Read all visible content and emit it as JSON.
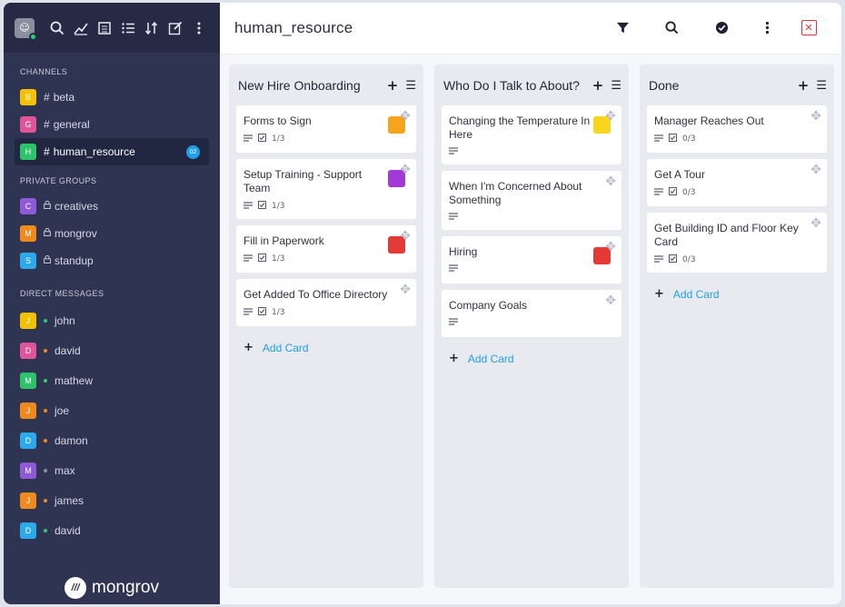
{
  "sidebar": {
    "avatar_glyph": "☺",
    "top_icons": [
      "search-icon",
      "chart-icon",
      "directory-icon",
      "list-icon",
      "sort-icon",
      "edit-icon",
      "more-icon"
    ],
    "sections": {
      "channels": "CHANNELS",
      "private_groups": "PRIVATE GROUPS",
      "direct_messages": "DIRECT MESSAGES"
    },
    "channels": [
      {
        "letter": "B",
        "name": "beta",
        "color": "#f2c200"
      },
      {
        "letter": "G",
        "name": "general",
        "color": "#e0559a"
      },
      {
        "letter": "H",
        "name": "human_resource",
        "color": "#2ec36b",
        "badge": "02"
      }
    ],
    "groups": [
      {
        "letter": "C",
        "name": "creatives",
        "color": "#8e5ad8"
      },
      {
        "letter": "M",
        "name": "mongrov",
        "color": "#f08a1c"
      },
      {
        "letter": "S",
        "name": "standup",
        "color": "#2ba9e8"
      }
    ],
    "dms": [
      {
        "letter": "J",
        "name": "john",
        "color": "#f2c200",
        "status": "#2ecc71"
      },
      {
        "letter": "D",
        "name": "david",
        "color": "#e0559a",
        "status": "#f08a1c"
      },
      {
        "letter": "M",
        "name": "mathew",
        "color": "#2ec36b",
        "status": "#2ecc71"
      },
      {
        "letter": "J",
        "name": "joe",
        "color": "#f08a1c",
        "status": "#f08a1c"
      },
      {
        "letter": "D",
        "name": "damon",
        "color": "#2ba9e8",
        "status": "#f08a1c"
      },
      {
        "letter": "M",
        "name": "max",
        "color": "#8e5ad8",
        "status": "#8a8f9e"
      },
      {
        "letter": "J",
        "name": "james",
        "color": "#f08a1c",
        "status": "#f08a1c"
      },
      {
        "letter": "D",
        "name": "david",
        "color": "#2ba9e8",
        "status": "#2ecc71"
      }
    ],
    "brand": {
      "logo_glyph": "///",
      "name": "mongrov"
    }
  },
  "header": {
    "title": "human_resource",
    "icons": [
      "filter-icon",
      "search-icon",
      "check-circle-icon",
      "more-icon",
      "close-icon"
    ]
  },
  "board": {
    "add_card_label": "Add Card",
    "columns": [
      {
        "title": "New Hire Onboarding",
        "cards": [
          {
            "title": "Forms to Sign",
            "checklist": "1/3",
            "label_color": "#f7a31b"
          },
          {
            "title": "Setup Training - Support Team",
            "checklist": "1/3",
            "label_color": "#a13ad6"
          },
          {
            "title": "Fill in Paperwork",
            "checklist": "1/3",
            "label_color": "#e53935"
          },
          {
            "title": "Get Added To Office Directory",
            "checklist": "1/3",
            "label_color": null
          }
        ]
      },
      {
        "title": "Who Do I Talk to About?",
        "cards": [
          {
            "title": "Changing the Temperature In Here",
            "checklist": null,
            "label_color": "#f7d51b"
          },
          {
            "title": "When I'm Concerned About Something",
            "checklist": null,
            "label_color": null
          },
          {
            "title": "Hiring",
            "checklist": null,
            "label_color": "#e53935"
          },
          {
            "title": "Company Goals",
            "checklist": null,
            "label_color": null
          }
        ]
      },
      {
        "title": "Done",
        "cards": [
          {
            "title": "Manager Reaches Out",
            "checklist": "0/3",
            "label_color": null
          },
          {
            "title": "Get A Tour",
            "checklist": "0/3",
            "label_color": null
          },
          {
            "title": "Get Building ID and Floor Key Card",
            "checklist": "0/3",
            "label_color": null
          }
        ]
      }
    ]
  }
}
